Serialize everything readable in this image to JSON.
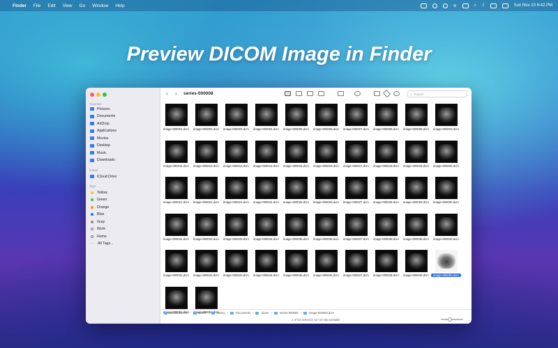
{
  "menubar": {
    "app": "Finder",
    "menus": [
      "File",
      "Edit",
      "View",
      "Go",
      "Window",
      "Help"
    ],
    "clock": "Sun Nov 10  6:42 PM"
  },
  "headline": "Preview DICOM Image in Finder",
  "window": {
    "title": "series-000008",
    "search_placeholder": "Search"
  },
  "sidebar": {
    "favorites_label": "Favorites",
    "favorites": [
      {
        "label": "Pictures",
        "icon": "pictures-icon"
      },
      {
        "label": "Documents",
        "icon": "documents-icon"
      },
      {
        "label": "AirDrop",
        "icon": "airdrop-icon"
      },
      {
        "label": "Applications",
        "icon": "applications-icon"
      },
      {
        "label": "Movies",
        "icon": "movies-icon"
      },
      {
        "label": "Desktop",
        "icon": "desktop-icon"
      },
      {
        "label": "Music",
        "icon": "music-icon"
      },
      {
        "label": "Downloads",
        "icon": "downloads-icon"
      }
    ],
    "icloud_label": "iCloud",
    "icloud": [
      {
        "label": "iCloud Drive",
        "icon": "icloud-icon"
      }
    ],
    "tags_label": "Tags",
    "tags": [
      {
        "label": "Yellow",
        "color": "#f5c518"
      },
      {
        "label": "Green",
        "color": "#34c759"
      },
      {
        "label": "Orange",
        "color": "#ff9500"
      },
      {
        "label": "Blue",
        "color": "#007aff"
      },
      {
        "label": "Gray",
        "color": "#8e8e93"
      },
      {
        "label": "Work",
        "color": "#ffffff"
      },
      {
        "label": "Home",
        "color": "#ffffff"
      },
      {
        "label": "All Tags...",
        "color": "none"
      }
    ]
  },
  "files": {
    "names": [
      "image-000001.dcm",
      "image-000002.dcm",
      "image-000003.dcm",
      "image-000004.dcm",
      "image-000005.dcm",
      "image-000006.dcm",
      "image-000007.dcm",
      "image-000008.dcm",
      "image-000009.dcm",
      "image-000010.dcm",
      "image-000011.dcm",
      "image-000012.dcm",
      "image-000013.dcm",
      "image-000014.dcm",
      "image-000015.dcm",
      "image-000016.dcm",
      "image-000017.dcm",
      "image-000018.dcm",
      "image-000019.dcm",
      "image-000020.dcm",
      "image-000021.dcm",
      "image-000022.dcm",
      "image-000023.dcm",
      "image-000024.dcm",
      "image-000025.dcm",
      "image-000026.dcm",
      "image-000027.dcm",
      "image-000028.dcm",
      "image-000029.dcm",
      "image-000030.dcm",
      "image-000031.dcm",
      "image-000032.dcm",
      "image-000033.dcm",
      "image-000034.dcm",
      "image-000035.dcm",
      "image-000036.dcm",
      "image-000037.dcm",
      "image-000038.dcm",
      "image-000039.dcm",
      "image-000040.dcm",
      "image-000041.dcm",
      "image-000042.dcm",
      "image-000043.dcm",
      "image-000044.dcm",
      "image-000045.dcm",
      "image-000046.dcm",
      "image-000047.dcm",
      "image-000048.dcm",
      "image-000049.dcm",
      "image-000050.dcm",
      "image-000051.dcm",
      "image-000052.dcm"
    ],
    "selected": "image-000050.dcm"
  },
  "pathbar": [
    "Macintosh HD",
    "Users",
    "danny",
    "Documents",
    "dicom",
    "series-000008",
    "image-000050.dcm"
  ],
  "status": "1 of 52 selected, 117.04 GB available",
  "icon_size_level": 0.4
}
